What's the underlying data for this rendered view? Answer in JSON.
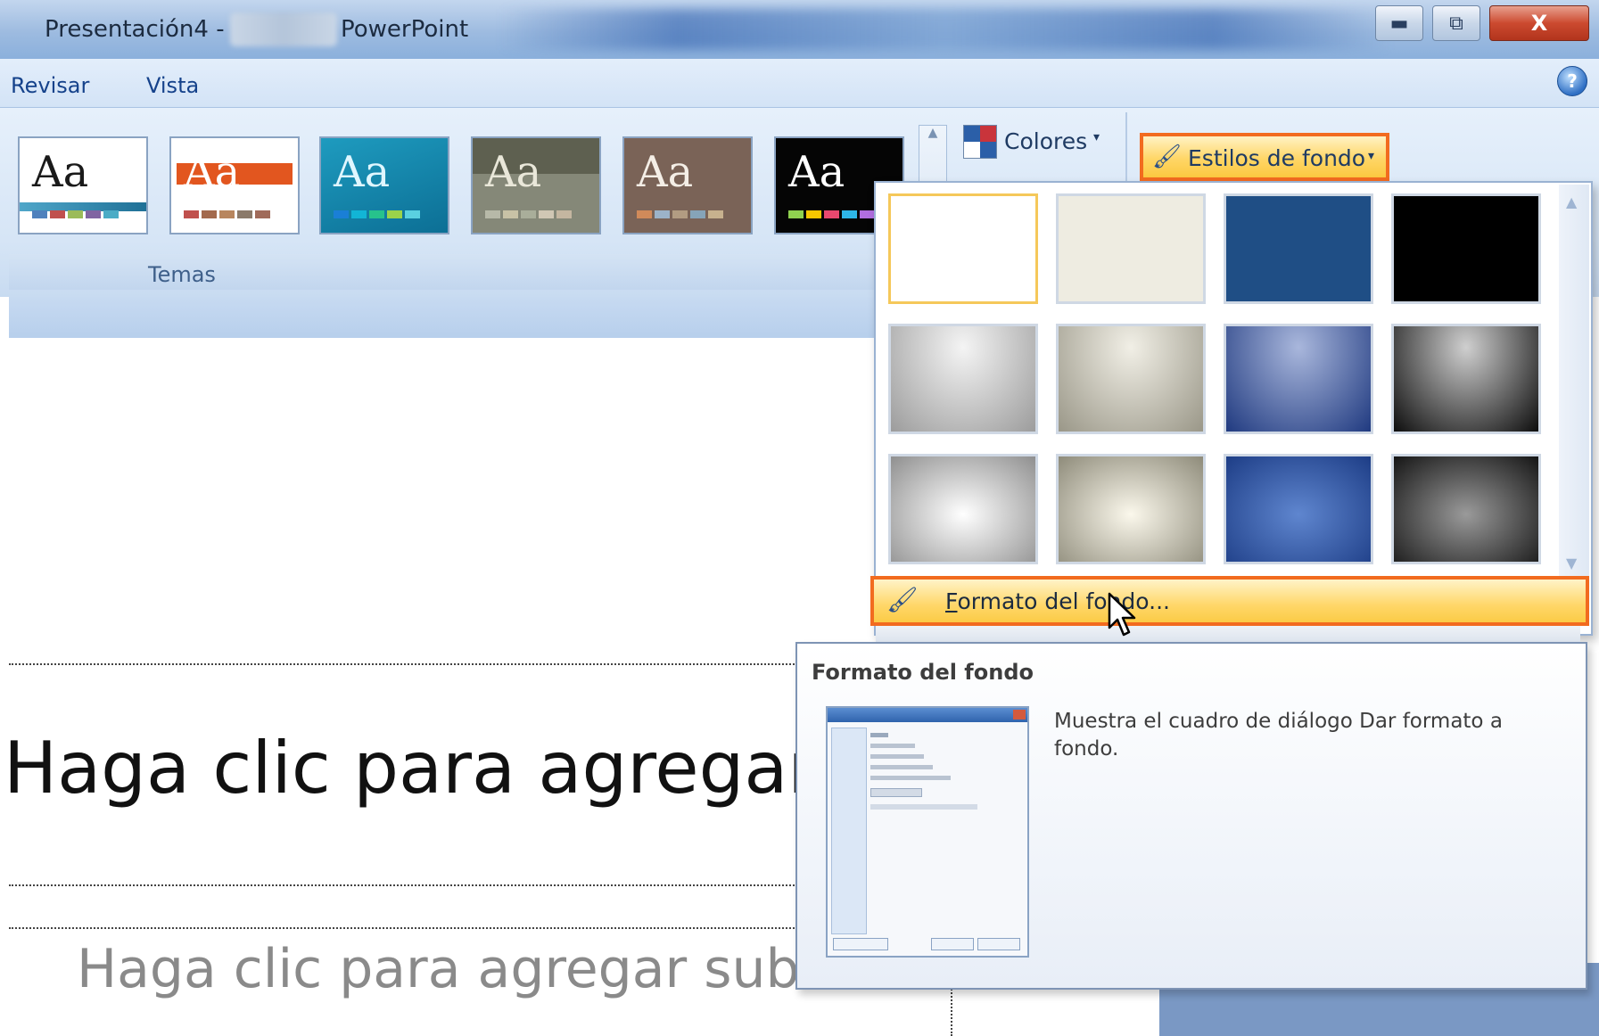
{
  "titlebar": {
    "doc_name": "Presentación4 -",
    "app_name": "PowerPoint",
    "min_glyph": "▬",
    "max_glyph": "⧉",
    "close_glyph": "X"
  },
  "menu": {
    "tabs": [
      {
        "label": "Revisar"
      },
      {
        "label": "Vista"
      }
    ],
    "help_glyph": "?"
  },
  "ribbon": {
    "themes_group_label": "Temas",
    "themes": [
      {
        "label": "Aa"
      },
      {
        "label": "Aa"
      },
      {
        "label": "Aa"
      },
      {
        "label": "Aa"
      },
      {
        "label": "Aa"
      },
      {
        "label": "Aa"
      }
    ],
    "colores_label": "Colores",
    "estilos_label": "Estilos de fondo",
    "dropdown_arrow": "▾",
    "scroll_up_glyph": "▲"
  },
  "dropdown": {
    "scroll_up": "▲",
    "scroll_down": "▼",
    "format_item_first": "F",
    "format_item_rest": "ormato del fondo..."
  },
  "tooltip": {
    "title": "Formato del fondo",
    "description": "Muestra el cuadro de diálogo Dar formato a fondo."
  },
  "slide": {
    "title_placeholder": "Haga clic para agregar tí",
    "subtitle_placeholder": "Haga clic para agregar subtítulo"
  },
  "colors": {
    "highlight_border": "#f26b1f",
    "highlight_fill": "#ffd666",
    "ribbon_bg": "#d6e5f6"
  }
}
